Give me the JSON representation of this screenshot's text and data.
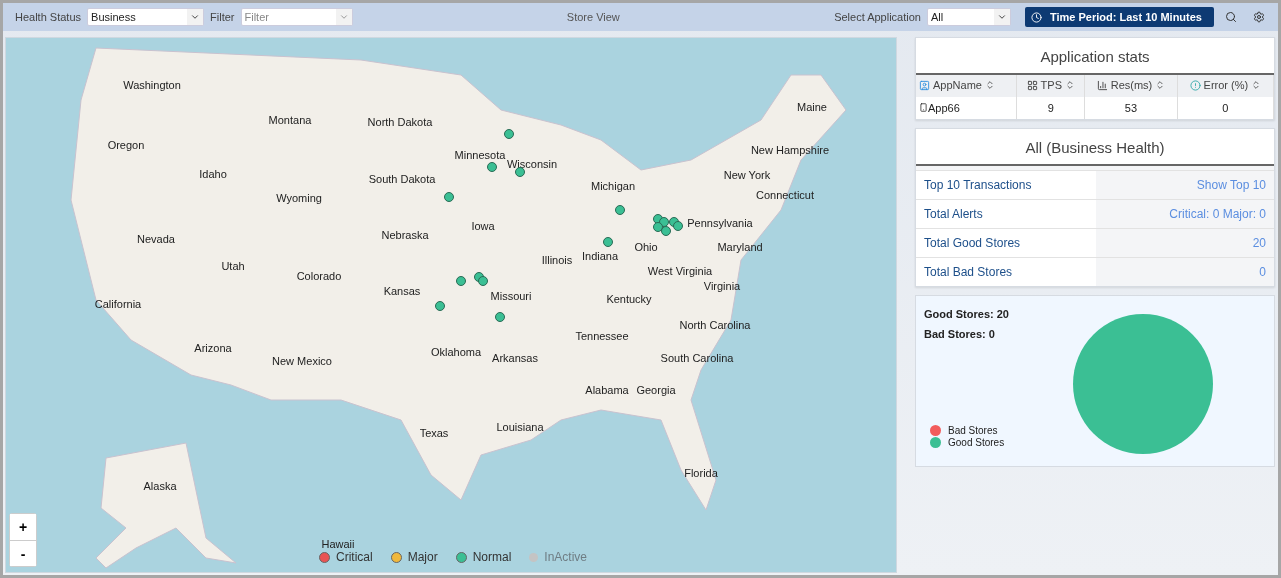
{
  "toolbar": {
    "health_status": {
      "label": "Health Status",
      "value": "Business"
    },
    "filter": {
      "label": "Filter",
      "placeholder": "Filter"
    },
    "view_title": "Store View",
    "select_application": {
      "label": "Select Application",
      "value": "All"
    },
    "time_period": "Time Period: Last 10 Minutes"
  },
  "map": {
    "states": [
      "Washington",
      "Montana",
      "North Dakota",
      "Minnesota",
      "Wisconsin",
      "Oregon",
      "Idaho",
      "South Dakota",
      "Michigan",
      "Maine",
      "New Hampshire",
      "New York",
      "Connecticut",
      "Wyoming",
      "Iowa",
      "Pennsylvania",
      "Nebraska",
      "Nevada",
      "Illinois",
      "Indiana",
      "Ohio",
      "Maryland",
      "Utah",
      "Colorado",
      "West Virginia",
      "Kansas",
      "Missouri",
      "Virginia",
      "California",
      "Kentucky",
      "North Carolina",
      "Tennessee",
      "Arizona",
      "Oklahoma",
      "New Mexico",
      "Arkansas",
      "South Carolina",
      "Alabama",
      "Georgia",
      "Texas",
      "Louisiana",
      "Florida",
      "Alaska",
      "Hawaii"
    ],
    "zoom_in": "+",
    "zoom_out": "-",
    "legend": [
      {
        "label": "Critical",
        "color": "#e85454",
        "disabled": false
      },
      {
        "label": "Major",
        "color": "#f0b83c",
        "disabled": false
      },
      {
        "label": "Normal",
        "color": "#3bbf94",
        "disabled": false
      },
      {
        "label": "InActive",
        "color": "#c4c4c4",
        "disabled": true
      }
    ]
  },
  "app_stats": {
    "title": "Application stats",
    "columns": [
      "AppName",
      "TPS",
      "Res(ms)",
      "Error (%)"
    ],
    "rows": [
      [
        "App66",
        "9",
        "53",
        "0"
      ]
    ]
  },
  "business_health": {
    "title": "All (Business Health)",
    "rows": [
      {
        "label": "Top 10 Transactions",
        "value": "Show Top 10"
      },
      {
        "label": "Total Alerts",
        "value": "Critical: 0 Major: 0"
      },
      {
        "label": "Total Good Stores",
        "value": "20"
      },
      {
        "label": "Total Bad Stores",
        "value": "0"
      }
    ]
  },
  "stores_chart": {
    "summary": [
      "Good Stores: 20",
      "Bad Stores: 0"
    ],
    "chart_data": {
      "type": "pie",
      "categories": [
        "Bad Stores",
        "Good Stores"
      ],
      "values": [
        0,
        100
      ],
      "colors": [
        "#f25c5c",
        "#3bbf94"
      ]
    }
  }
}
